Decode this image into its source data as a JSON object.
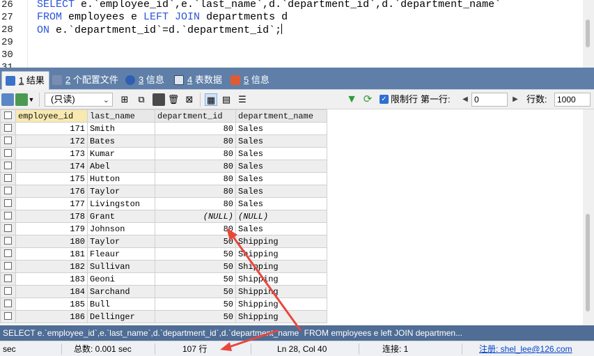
{
  "editor": {
    "line_numbers": [
      "26",
      "27",
      "28",
      "29",
      "30",
      "31"
    ],
    "lines": [
      [
        {
          "t": "SELECT",
          "k": true
        },
        {
          "t": " e.`employee_id`,e.`last_name`,d.`department_id`,d.`department_name`",
          "k": false
        }
      ],
      [
        {
          "t": "FROM",
          "k": true
        },
        {
          "t": " employees e ",
          "k": false
        },
        {
          "t": "LEFT JOIN",
          "k": true
        },
        {
          "t": " departments d",
          "k": false
        }
      ],
      [
        {
          "t": "ON",
          "k": true
        },
        {
          "t": " e.`department_id`=d.`department_id`;",
          "k": false
        }
      ],
      [],
      []
    ]
  },
  "tabs": [
    {
      "num": "1",
      "label": "结果",
      "icon": "result-grid-icon",
      "color": "#3b73c9",
      "active": true
    },
    {
      "num": "2",
      "label": "个配置文件",
      "icon": "profile-icon",
      "color": "#7a8db0",
      "active": false
    },
    {
      "num": "3",
      "label": "信息",
      "icon": "info-icon",
      "color": "#2f5fb3",
      "active": false
    },
    {
      "num": "4",
      "label": "表数据",
      "icon": "table-data-icon",
      "color": "#dfe6ef",
      "active": false
    },
    {
      "num": "5",
      "label": "信息",
      "icon": "info-color-icon",
      "color": "#e05a33",
      "active": false
    }
  ],
  "toolbar": {
    "mode_value": "(只读)",
    "limit_label": "限制行",
    "first_row_label": "第一行:",
    "first_row_value": "0",
    "rows_label": "行数:",
    "rows_value": "1000",
    "accent": "#2f6fd1"
  },
  "grid": {
    "columns": [
      "employee_id",
      "last_name",
      "department_id",
      "department_name"
    ],
    "selected_column": 0,
    "rows": [
      [
        "171",
        "Smith",
        "80",
        "Sales"
      ],
      [
        "172",
        "Bates",
        "80",
        "Sales"
      ],
      [
        "173",
        "Kumar",
        "80",
        "Sales"
      ],
      [
        "174",
        "Abel",
        "80",
        "Sales"
      ],
      [
        "175",
        "Hutton",
        "80",
        "Sales"
      ],
      [
        "176",
        "Taylor",
        "80",
        "Sales"
      ],
      [
        "177",
        "Livingston",
        "80",
        "Sales"
      ],
      [
        "178",
        "Grant",
        "(NULL)",
        "(NULL)"
      ],
      [
        "179",
        "Johnson",
        "80",
        "Sales"
      ],
      [
        "180",
        "Taylor",
        "50",
        "Shipping"
      ],
      [
        "181",
        "Fleaur",
        "50",
        "Shipping"
      ],
      [
        "182",
        "Sullivan",
        "50",
        "Shipping"
      ],
      [
        "183",
        "Geoni",
        "50",
        "Shipping"
      ],
      [
        "184",
        "Sarchand",
        "50",
        "Shipping"
      ],
      [
        "185",
        "Bull",
        "50",
        "Shipping"
      ],
      [
        "186",
        "Dellinger",
        "50",
        "Shipping"
      ]
    ]
  },
  "sql_status": "SELECT e.`employee_id`,e.`last_name`,d.`department_id`,d.`department_name` FROM employees e left JOIN departmen...",
  "status": {
    "exec_time": "sec",
    "total_time": "总数: 0.001 sec",
    "row_count": "107 行",
    "cursor": "Ln 28, Col 40",
    "connections": "连接: 1",
    "register": "注册:  shel_lee@126.com"
  },
  "annotation_color": "#e8473c"
}
